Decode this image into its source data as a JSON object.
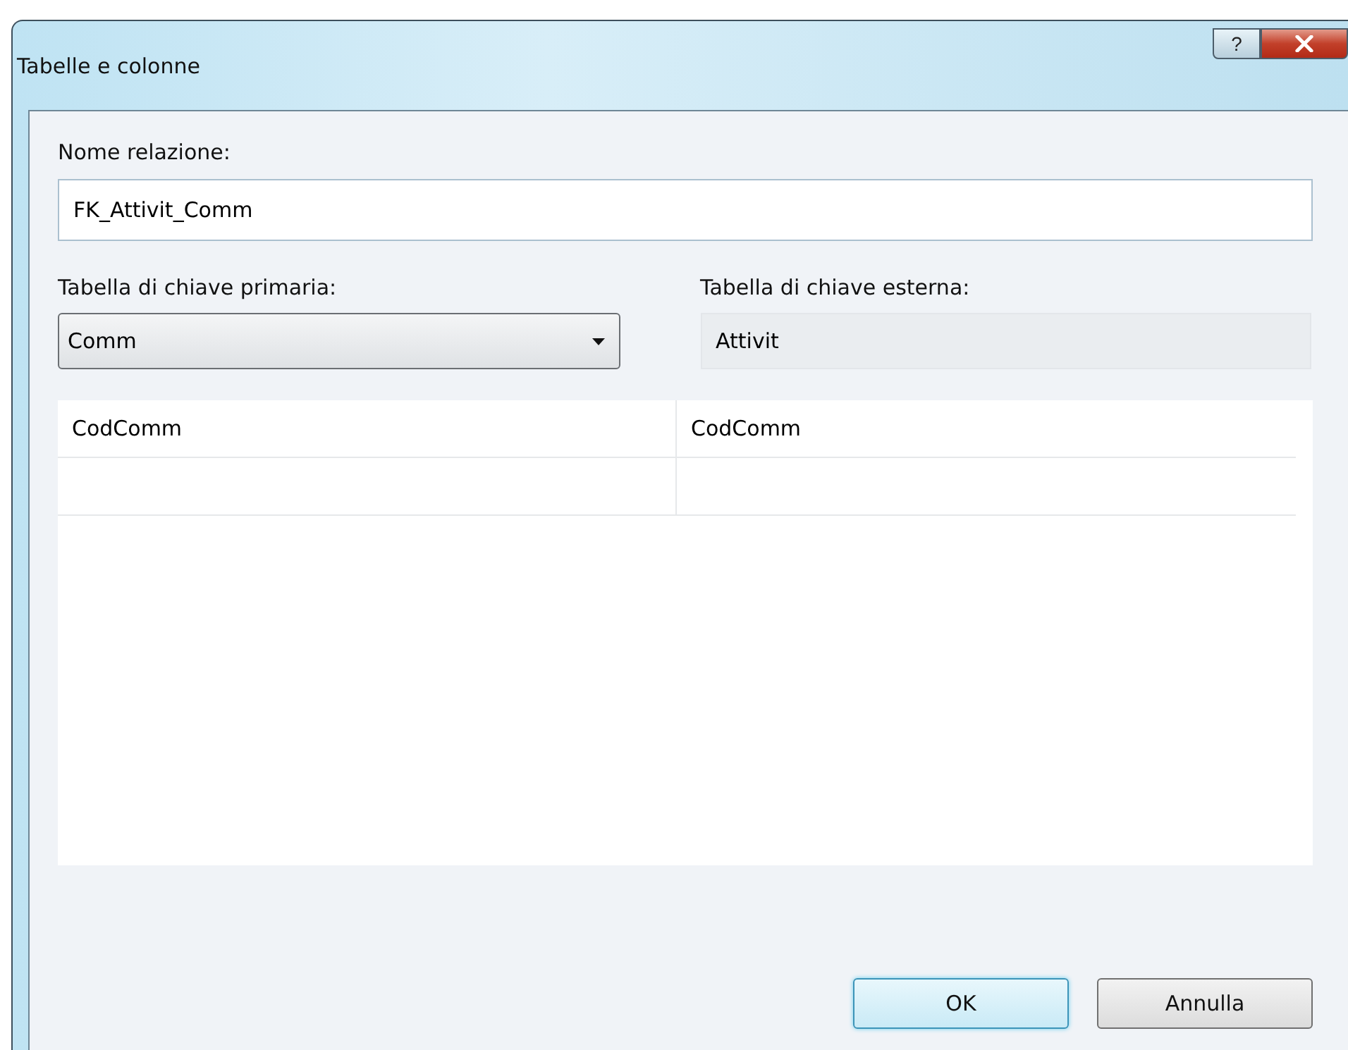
{
  "window": {
    "title": "Tabelle e colonne",
    "help": "?"
  },
  "name_field": {
    "label": "Nome relazione:",
    "value": "FK_Attivit_Comm"
  },
  "primary_table": {
    "label": "Tabella di chiave primaria:",
    "value": "Comm"
  },
  "foreign_table": {
    "label": "Tabella di chiave esterna:",
    "value": "Attivit"
  },
  "column_grid": {
    "rows": [
      {
        "cells": [
          "CodComm",
          "CodComm"
        ]
      }
    ]
  },
  "buttons": [
    {
      "label": "OK",
      "default": true
    },
    {
      "label": "Annulla",
      "default": false
    }
  ]
}
